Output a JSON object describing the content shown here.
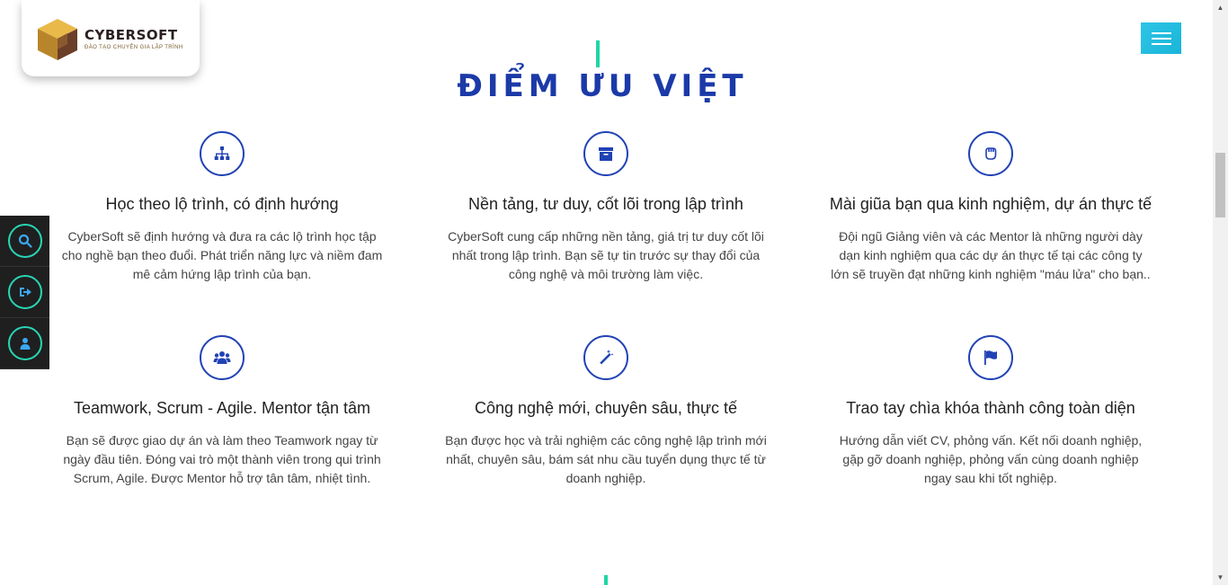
{
  "header": {
    "logo_name": "CYBERSOFT",
    "logo_tagline": "ĐÀO TẠO CHUYÊN GIA LẬP TRÌNH",
    "menu_icon": "hamburger-icon"
  },
  "section": {
    "title": "ĐIỂM ƯU VIỆT"
  },
  "features": [
    {
      "icon": "sitemap-icon",
      "title": "Học theo lộ trình, có định hướng",
      "text": "CyberSoft sẽ định hướng và đưa ra các lộ trình học tập cho nghề bạn theo đuổi. Phát triển năng lực và niềm đam mê cảm hứng lập trình của bạn."
    },
    {
      "icon": "archive-icon",
      "title": "Nền tảng, tư duy, cốt lõi trong lập trình",
      "text": "CyberSoft cung cấp những nền tảng, giá trị tư duy cốt lõi nhất trong lập trình. Bạn sẽ tự tin trước sự thay đổi của công nghệ và môi trường làm việc."
    },
    {
      "icon": "hand-fist-icon",
      "title": "Mài giũa bạn qua kinh nghiệm, dự án thực tế",
      "text": "Đội ngũ Giảng viên và các Mentor là những người dày dạn kinh nghiệm qua các dự án thực tế tại các công ty lớn sẽ truyền đạt những kinh nghiệm \"máu lửa\" cho bạn.."
    },
    {
      "icon": "users-icon",
      "title": "Teamwork, Scrum - Agile. Mentor tận tâm",
      "text": "Bạn sẽ được giao dự án và làm theo Teamwork ngay từ ngày đầu tiên. Đóng vai trò một thành viên trong qui trình Scrum, Agile. Được Mentor hỗ trợ tân tâm, nhiệt tình."
    },
    {
      "icon": "magic-wand-icon",
      "title": "Công nghệ mới, chuyên sâu, thực tế",
      "text": "Bạn được học và trải nghiệm các công nghệ lập trình mới nhất, chuyên sâu, bám sát nhu cầu tuyển dụng thực tế từ doanh nghiệp."
    },
    {
      "icon": "flag-icon",
      "title": "Trao tay chìa khóa thành công toàn diện",
      "text": "Hướng dẫn viết CV, phỏng vấn. Kết nối doanh nghiệp, gặp gỡ doanh nghiệp, phỏng vấn cùng doanh nghiệp ngay sau khi tốt nghiệp."
    }
  ],
  "sidebar": {
    "items": [
      "search-icon",
      "sign-in-icon",
      "user-icon"
    ]
  },
  "colors": {
    "title": "#1b3aa8",
    "accent": "#1fd6a6",
    "icon_blue": "#2142b5",
    "menu_button": "#19b5d8",
    "sidebar_bg": "#1f1f1f"
  }
}
